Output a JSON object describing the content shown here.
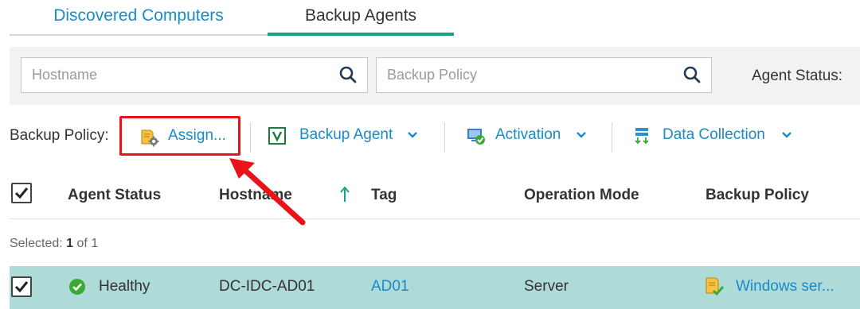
{
  "tabs": [
    {
      "label": "Discovered Computers",
      "active": false
    },
    {
      "label": "Backup Agents",
      "active": true
    }
  ],
  "filters": {
    "hostname_placeholder": "Hostname",
    "hostname_value": "",
    "policy_placeholder": "Backup Policy",
    "policy_value": "",
    "agent_status_label": "Agent Status:"
  },
  "toolbar": {
    "policy_label": "Backup Policy:",
    "assign_label": "Assign...",
    "backup_agent_label": "Backup Agent",
    "activation_label": "Activation",
    "data_collection_label": "Data Collection"
  },
  "table": {
    "columns": [
      "Agent Status",
      "Hostname",
      "Tag",
      "Operation Mode",
      "Backup Policy"
    ],
    "sort_column": "Hostname",
    "sort_direction": "ascending",
    "selected_label": "Selected:",
    "selected_count": "1",
    "selected_of": "of 1",
    "rows": [
      {
        "checked": true,
        "agent_status": "Healthy",
        "hostname": "DC-IDC-AD01",
        "tag": "AD01",
        "operation_mode": "Server",
        "backup_policy": "Windows ser..."
      }
    ]
  },
  "colors": {
    "accent_blue": "#1a8bc6",
    "active_tab_underline": "#15a38a",
    "highlight_border": "#e8141a",
    "selected_row_bg": "#aedbd7",
    "healthy_green": "#3aaa35"
  }
}
